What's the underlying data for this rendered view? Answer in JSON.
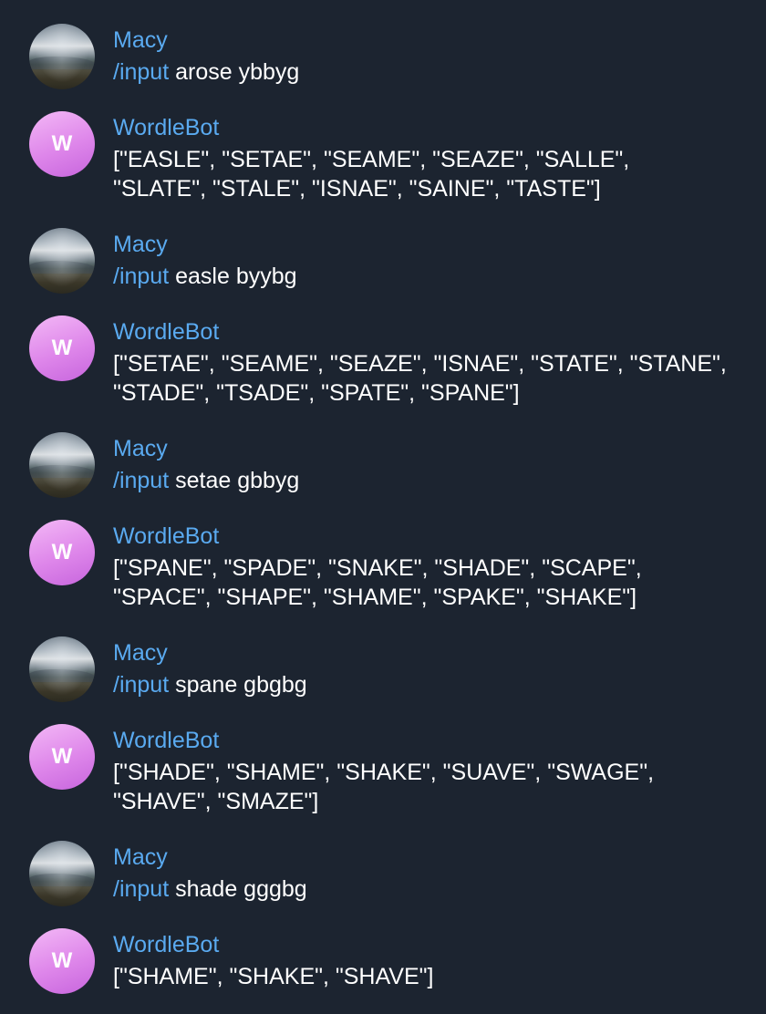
{
  "messages": [
    {
      "sender": "Macy",
      "command": "/input",
      "text": " arose ybbyg"
    },
    {
      "sender": "WordleBot",
      "avatar_letter": "W",
      "line1": "[\"EASLE\", \"SETAE\", \"SEAME\", \"SEAZE\", \"SALLE\",",
      "line2": "\"SLATE\", \"STALE\", \"ISNAE\", \"SAINE\", \"TASTE\"]"
    },
    {
      "sender": "Macy",
      "command": "/input",
      "text": " easle byybg"
    },
    {
      "sender": "WordleBot",
      "avatar_letter": "W",
      "line1": "[\"SETAE\", \"SEAME\", \"SEAZE\", \"ISNAE\", \"STATE\", \"STANE\",",
      "line2": "\"STADE\", \"TSADE\", \"SPATE\", \"SPANE\"]"
    },
    {
      "sender": "Macy",
      "command": "/input",
      "text": " setae gbbyg"
    },
    {
      "sender": "WordleBot",
      "avatar_letter": "W",
      "line1": "[\"SPANE\", \"SPADE\", \"SNAKE\", \"SHADE\", \"SCAPE\",",
      "line2": "\"SPACE\", \"SHAPE\", \"SHAME\", \"SPAKE\", \"SHAKE\"]"
    },
    {
      "sender": "Macy",
      "command": "/input",
      "text": " spane gbgbg"
    },
    {
      "sender": "WordleBot",
      "avatar_letter": "W",
      "line1": "[\"SHADE\", \"SHAME\", \"SHAKE\", \"SUAVE\", \"SWAGE\",",
      "line2": "\"SHAVE\", \"SMAZE\"]"
    },
    {
      "sender": "Macy",
      "command": "/input",
      "text": " shade gggbg"
    },
    {
      "sender": "WordleBot",
      "avatar_letter": "W",
      "line1": "[\"SHAME\", \"SHAKE\", \"SHAVE\"]"
    }
  ],
  "colors": {
    "background": "#1c2430",
    "name": "#5aaaf0",
    "command": "#5aaaf0",
    "text": "#ffffff",
    "bot_avatar": "#de86ea"
  }
}
